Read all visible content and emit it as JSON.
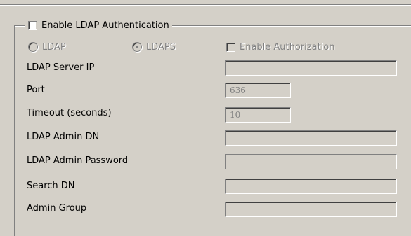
{
  "group": {
    "enable_ldap_auth": {
      "label": "Enable LDAP Authentication",
      "checked": false
    }
  },
  "protocol": {
    "ldap_label": "LDAP",
    "ldaps_label": "LDAPS",
    "selected": "LDAPS",
    "enabled": false
  },
  "enable_authorization": {
    "label": "Enable Authorization",
    "checked": false,
    "enabled": false
  },
  "fields": {
    "server_ip": {
      "label": "LDAP Server IP",
      "value": ""
    },
    "port": {
      "label": "Port",
      "value": "636"
    },
    "timeout": {
      "label": "Timeout (seconds)",
      "value": "10"
    },
    "admin_dn": {
      "label": "LDAP Admin DN",
      "value": ""
    },
    "admin_password": {
      "label": "LDAP Admin  Password",
      "value": ""
    },
    "search_dn": {
      "label": "Search DN",
      "value": ""
    },
    "admin_group": {
      "label": "Admin Group",
      "value": ""
    }
  },
  "colors": {
    "dialog_background": "#d4d0c8",
    "disabled_text": "#808080",
    "shadow": "#808080",
    "highlight": "#ffffff"
  }
}
